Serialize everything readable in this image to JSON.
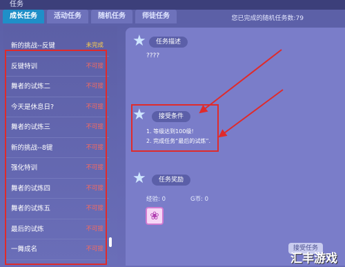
{
  "window": {
    "title": "任务"
  },
  "tabs": [
    {
      "label": "成长任务",
      "active": true
    },
    {
      "label": "活动任务"
    },
    {
      "label": "随机任务"
    },
    {
      "label": "师徒任务"
    }
  ],
  "random_count": "您已完成的随机任务数:79",
  "task_list": [
    {
      "name": "新的挑战--反键",
      "status": "未完成"
    },
    {
      "name": "反键特训",
      "status": "不可接"
    },
    {
      "name": "舞者的试炼二",
      "status": "不可接"
    },
    {
      "name": "今天是休息日?",
      "status": "不可接"
    },
    {
      "name": "舞者的试炼三",
      "status": "不可接"
    },
    {
      "name": "新的挑战--8键",
      "status": "不可接"
    },
    {
      "name": "强化特训",
      "status": "不可接"
    },
    {
      "name": "舞者的试炼四",
      "status": "不可接"
    },
    {
      "name": "舞者的试炼五",
      "status": "不可接"
    },
    {
      "name": "最后的试炼",
      "status": "不可接"
    },
    {
      "name": "一舞成名",
      "status": "不可接"
    }
  ],
  "sections": {
    "desc": {
      "title": "任务描述",
      "text": "????"
    },
    "req": {
      "title": "接受条件",
      "lines": [
        "1. 等级达到100级!",
        "2. 完成任务“最后的试炼”."
      ]
    },
    "reward": {
      "title": "任务奖励",
      "exp_label": "经验: 0",
      "gold_label": "G币: 0"
    }
  },
  "accept_button": "接受任务",
  "watermark": "汇丰游戏",
  "colors": {
    "highlight": "#e02a2a",
    "tab_active": "#1f8fc8"
  }
}
